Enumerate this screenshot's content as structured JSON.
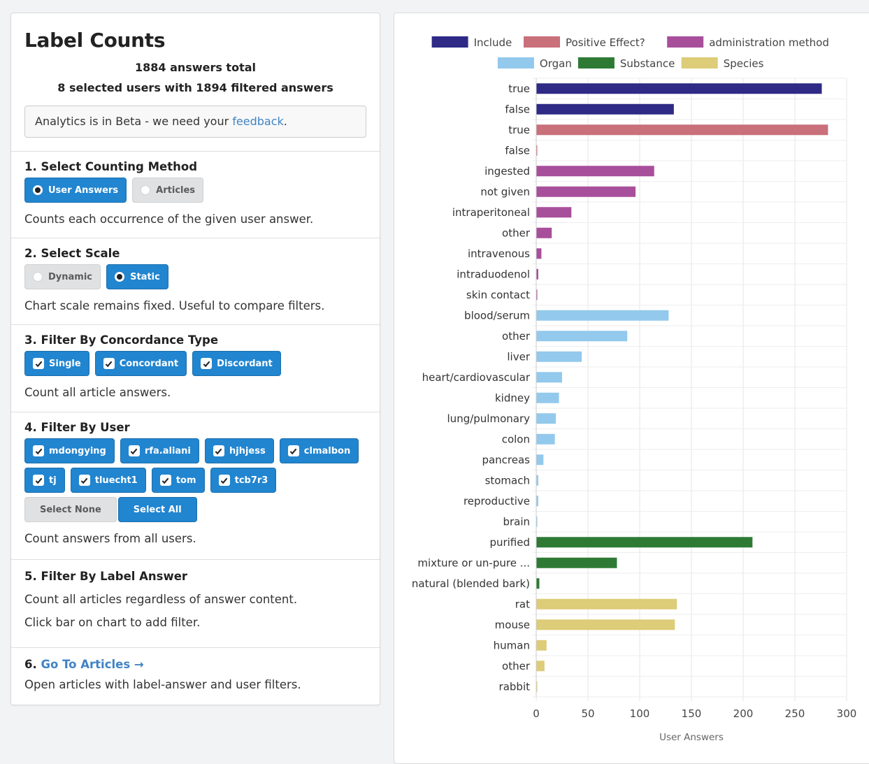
{
  "header": {
    "title": "Label Counts",
    "answers_total": "1884 answers total",
    "selected_users": "8 selected users with 1894 filtered answers",
    "beta_text": "Analytics is in Beta - we need your ",
    "beta_link": "feedback",
    "beta_end": "."
  },
  "counting": {
    "title": "1. Select Counting Method",
    "options": [
      "User Answers",
      "Articles"
    ],
    "selected": "User Answers",
    "description": "Counts each occurrence of the given user answer."
  },
  "scale": {
    "title": "2. Select Scale",
    "options": [
      "Dynamic",
      "Static"
    ],
    "selected": "Static",
    "description": "Chart scale remains fixed. Useful to compare filters."
  },
  "concordance": {
    "title": "3. Filter By Concordance Type",
    "options": [
      "Single",
      "Concordant",
      "Discordant"
    ],
    "description": "Count all article answers."
  },
  "users": {
    "title": "4. Filter By User",
    "list": [
      "mdongying",
      "rfa.aliani",
      "hjhjess",
      "clmalbon",
      "tj",
      "tluecht1",
      "tom",
      "tcb7r3"
    ],
    "select_none": "Select None",
    "select_all": "Select All",
    "description": "Count answers from all users."
  },
  "label_answer": {
    "title": "5. Filter By Label Answer",
    "description": "Count all articles regardless of answer content.",
    "hint": "Click bar on chart to add filter."
  },
  "goto": {
    "prefix": "6. ",
    "link": "Go To Articles",
    "arrow": "→",
    "description": "Open articles with label-answer and user filters."
  },
  "chart_data": {
    "type": "bar",
    "orientation": "horizontal",
    "xlabel": "User Answers",
    "xlim": [
      0,
      300
    ],
    "xticks": [
      0,
      50,
      100,
      150,
      200,
      250,
      300
    ],
    "grid": true,
    "legend_placement": "top",
    "legend": [
      {
        "name": "Include",
        "color": "#2e2a85"
      },
      {
        "name": "Positive Effect?",
        "color": "#c9707a"
      },
      {
        "name": "administration method",
        "color": "#a84f9c"
      },
      {
        "name": "Organ",
        "color": "#93c9ec"
      },
      {
        "name": "Substance",
        "color": "#2e7a35"
      },
      {
        "name": "Species",
        "color": "#ddcc78"
      }
    ],
    "series": [
      {
        "name": "Include",
        "categories": [
          "true",
          "false"
        ],
        "values": [
          276,
          133
        ]
      },
      {
        "name": "Positive Effect?",
        "categories": [
          "true",
          "false"
        ],
        "values": [
          282,
          1
        ]
      },
      {
        "name": "administration method",
        "categories": [
          "ingested",
          "not given",
          "intraperitoneal",
          "other",
          "intravenous",
          "intraduodenol",
          "skin contact"
        ],
        "values": [
          114,
          96,
          34,
          15,
          5,
          2,
          1
        ]
      },
      {
        "name": "Organ",
        "categories": [
          "blood/serum",
          "other",
          "liver",
          "heart/cardiovascular",
          "kidney",
          "lung/pulmonary",
          "colon",
          "pancreas",
          "stomach",
          "reproductive",
          "brain"
        ],
        "values": [
          128,
          88,
          44,
          25,
          22,
          19,
          18,
          7,
          2,
          2,
          1
        ]
      },
      {
        "name": "Substance",
        "categories": [
          "purified",
          "mixture or un-pure ...",
          "natural (blended bark)"
        ],
        "values": [
          209,
          78,
          3
        ]
      },
      {
        "name": "Species",
        "categories": [
          "rat",
          "mouse",
          "human",
          "other",
          "rabbit"
        ],
        "values": [
          136,
          134,
          10,
          8,
          1
        ]
      }
    ]
  }
}
